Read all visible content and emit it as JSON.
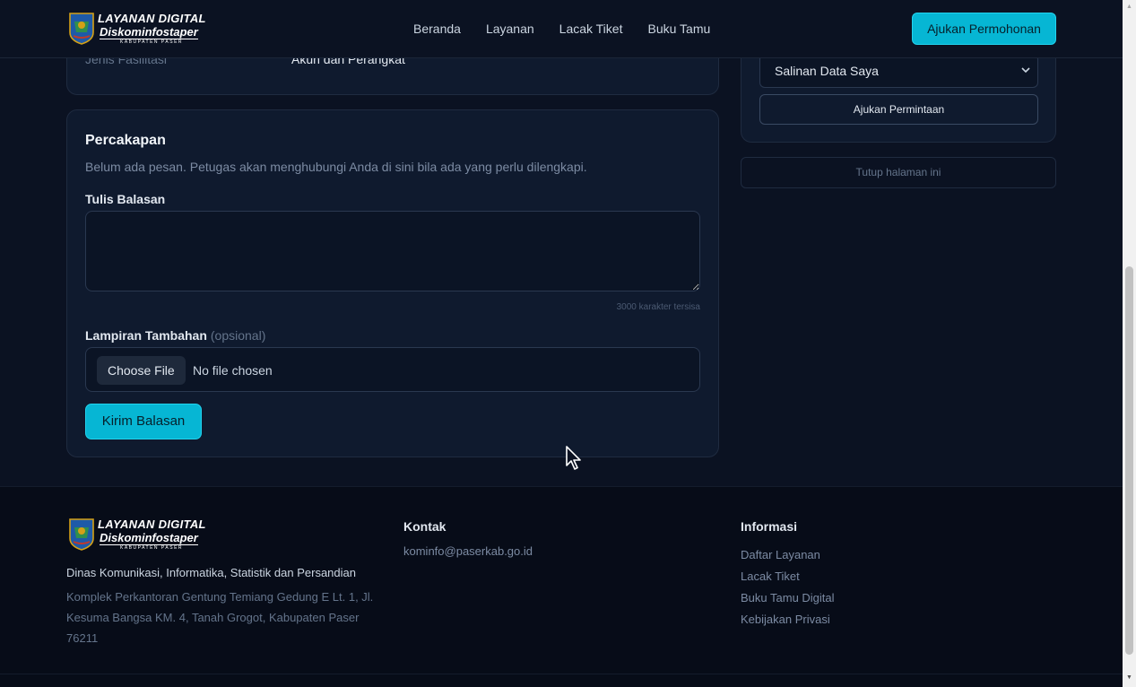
{
  "header": {
    "logo_line1": "LAYANAN DIGITAL",
    "logo_line2": "Diskominfostaper",
    "logo_line3": "KABUPATEN PASER",
    "nav": [
      "Beranda",
      "Layanan",
      "Lacak Tiket",
      "Buku Tamu"
    ],
    "cta_label": "Ajukan Permohonan"
  },
  "ticket_info": {
    "label": "Jenis Fasilitasi",
    "value": "Akun dan Perangkat"
  },
  "conversation": {
    "title": "Percakapan",
    "empty_message": "Belum ada pesan. Petugas akan menghubungi Anda di sini bila ada yang perlu dilengkapi.",
    "reply_label": "Tulis Balasan",
    "reply_value": "",
    "char_counter": "3000 karakter tersisa",
    "attachment_label": "Lampiran Tambahan",
    "attachment_optional": "(opsional)",
    "choose_file_label": "Choose File",
    "no_file_label": "No file chosen",
    "send_label": "Kirim Balasan"
  },
  "sidebar": {
    "select_value": "Salinan Data Saya",
    "request_label": "Ajukan Permintaan",
    "close_page_label": "Tutup halaman ini"
  },
  "footer": {
    "org_name": "Dinas Komunikasi, Informatika, Statistik dan Persandian",
    "address": "Komplek Perkantoran Gentung Temiang Gedung E Lt. 1, Jl. Kesuma Bangsa KM. 4, Tanah Grogot, Kabupaten Paser 76211",
    "contact_title": "Kontak",
    "email": "kominfo@paserkab.go.id",
    "info_title": "Informasi",
    "info_links": [
      "Daftar Layanan",
      "Lacak Tiket",
      "Buku Tamu Digital",
      "Kebijakan Privasi"
    ]
  },
  "colors": {
    "background": "#0b1222",
    "card": "#0f1a2e",
    "accent": "#06b6d4",
    "footer": "#070c18"
  },
  "icons": [
    "emblem-icon",
    "chevron-down-icon",
    "resize-grip-icon",
    "mouse-cursor-icon",
    "scroll-up-arrow-icon",
    "scroll-down-arrow-icon"
  ]
}
